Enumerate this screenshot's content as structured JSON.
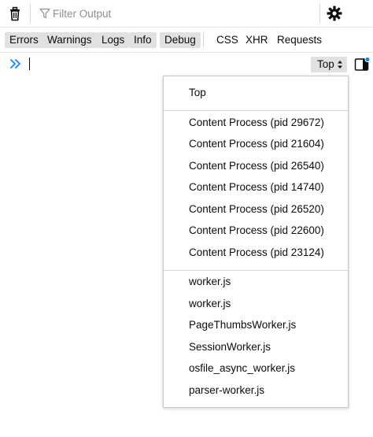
{
  "toolbar": {
    "clear_icon": "trash-icon",
    "filter_placeholder": "Filter Output",
    "settings_icon": "gear-icon"
  },
  "filters": {
    "levels": [
      {
        "label": "Errors",
        "active": true
      },
      {
        "label": "Warnings",
        "active": true
      },
      {
        "label": "Logs",
        "active": true
      },
      {
        "label": "Info",
        "active": true
      },
      {
        "label": "Debug",
        "active": true
      }
    ],
    "categories": [
      {
        "label": "CSS",
        "active": false
      },
      {
        "label": "XHR",
        "active": false
      },
      {
        "label": "Requests",
        "active": false
      }
    ]
  },
  "input": {
    "prompt_icon": "double-chevron-right-icon",
    "value": ""
  },
  "context_selector": {
    "selected": "Top",
    "icon": "up-down-arrows-icon"
  },
  "sidebar_toggle_icon": "sidebar-toggle-icon",
  "accent": "#0a84ff",
  "context_menu": {
    "top_item": "Top",
    "content_processes": [
      "Content Process (pid 29672)",
      "Content Process (pid 21604)",
      "Content Process (pid 26540)",
      "Content Process (pid 14740)",
      "Content Process (pid 26520)",
      "Content Process (pid 22600)",
      "Content Process (pid 23124)"
    ],
    "workers": [
      "worker.js",
      "worker.js",
      "PageThumbsWorker.js",
      "SessionWorker.js",
      "osfile_async_worker.js",
      "parser-worker.js"
    ]
  }
}
